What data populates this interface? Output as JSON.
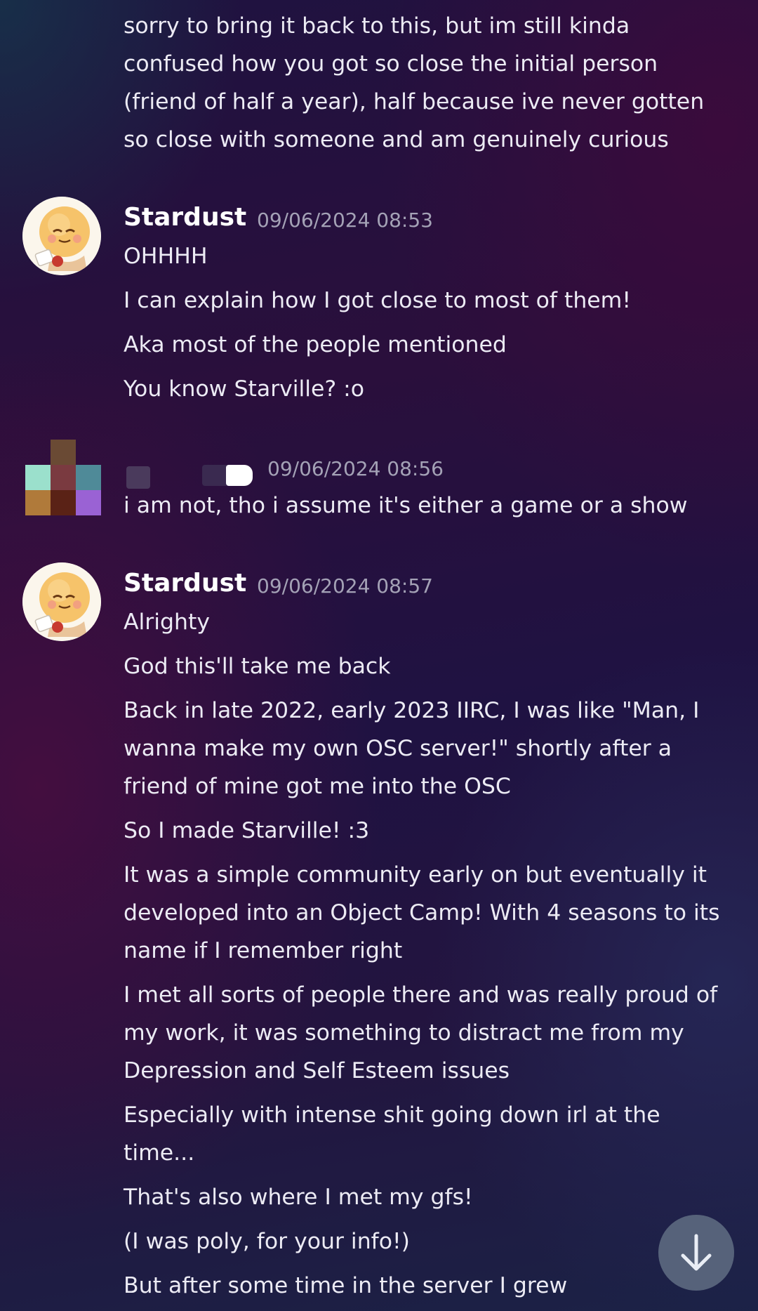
{
  "messages": [
    {
      "continuation": true,
      "lines": [
        "sorry to bring it back to this, but im still kinda",
        "confused how you got so close the initial person",
        "(friend of half a year), half because ive never gotten",
        "so close with someone and am genuinely curious"
      ]
    },
    {
      "author": "Stardust",
      "timestamp": "09/06/2024 08:53",
      "lines": [
        "OHHHH",
        "I can explain how I got close to most of them!",
        "Aka most of the people mentioned",
        "You know Starville? :o"
      ]
    },
    {
      "author": "",
      "author_redacted": true,
      "timestamp": "09/06/2024 08:56",
      "lines": [
        "i am not, tho i assume it's either a game or a show"
      ]
    },
    {
      "author": "Stardust",
      "timestamp": "09/06/2024 08:57",
      "lines": [
        "Alrighty",
        "God this'll take me back",
        "Back in late 2022, early 2023 IIRC, I was like \"Man, I",
        "wanna make my own OSC server!\" shortly after a",
        "friend of mine got me into the OSC",
        "So I made Starville! :3",
        "It was a simple community early on but eventually it",
        "developed into an Object Camp! With 4 seasons to its",
        "name if I remember right",
        "I met all sorts of people there and was really proud of",
        "my work, it was something to distract me from my",
        "Depression and Self Esteem issues",
        "Especially with intense shit going down irl at the",
        "time...",
        "That's also where I met my gfs!",
        "(I was poly, for your info!)",
        "But after some time in the server I grew"
      ]
    }
  ],
  "icons": {
    "stardust_avatar": "stardust-avatar-icon",
    "pixel_avatar": "pixelated-avatar-icon",
    "scroll_button": "arrow-down-icon"
  },
  "colors": {
    "username": "#ffffff",
    "timestamp": "#a4a2b6",
    "text": "#ecebf4",
    "scroll_button": "#56627a"
  }
}
